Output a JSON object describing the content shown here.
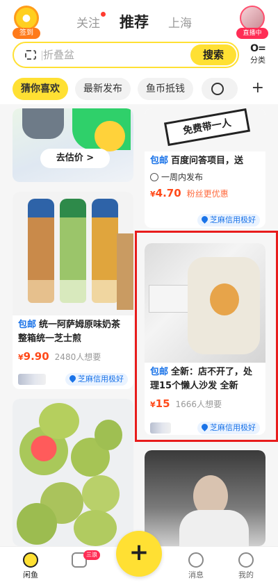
{
  "header": {
    "sign_label": "签到",
    "tabs": [
      "关注",
      "推荐",
      "上海"
    ],
    "live_label": "直播中",
    "search_placeholder": "折叠盆",
    "search_button": "搜索",
    "category_icon": "O=",
    "category_label": "分类",
    "chips": [
      "猜你喜欢",
      "最新发布",
      "鱼币抵钱"
    ]
  },
  "feed": {
    "left": [
      {
        "button": "去估价 >"
      },
      {
        "badge": "包邮",
        "title": "统一阿萨姆原味奶茶整箱统一芝士煎",
        "price": "9.90",
        "wants": "2480人想要",
        "credit": "芝麻信用极好"
      }
    ],
    "right": [
      {
        "image_text": "免费带一人",
        "badge": "包邮",
        "title": "百度问答项目，送",
        "time": "一周内发布",
        "price": "4.70",
        "fan": "粉丝更优惠",
        "credit": "芝麻信用极好"
      },
      {
        "badge": "包邮",
        "title": "全新：店不开了，处理15个懒人沙发 全新",
        "price": "15",
        "wants": "1666人想要",
        "credit": "芝麻信用极好"
      }
    ]
  },
  "nav": {
    "items": [
      "闲鱼",
      "",
      "消息",
      "我的"
    ],
    "badge": "三浪",
    "center": "+"
  },
  "currency": "¥",
  "colors": {
    "accent": "#ffe033",
    "price": "#ff4a1a",
    "link": "#1a73e8",
    "highlight": "#e81c1c"
  }
}
